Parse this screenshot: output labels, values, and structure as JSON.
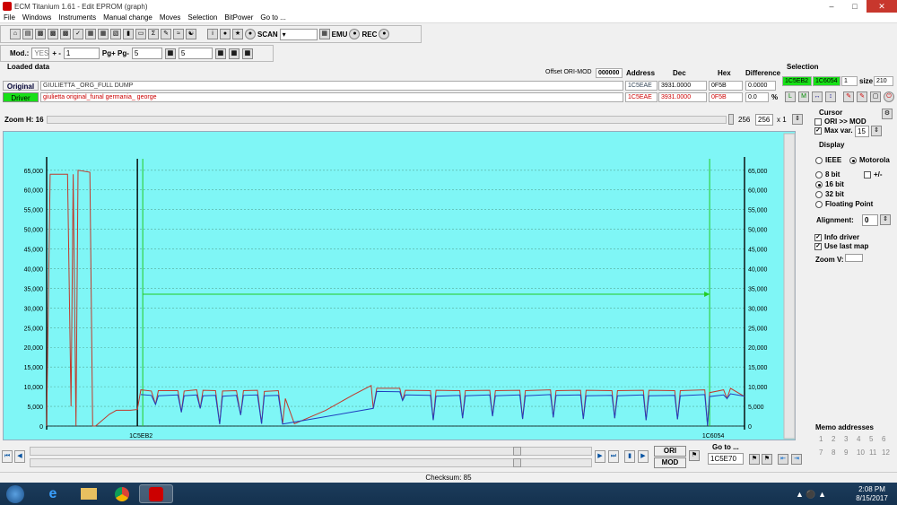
{
  "window": {
    "title": "ECM Titanium 1.61 - Edit EPROM (graph)"
  },
  "menu": [
    "File",
    "Windows",
    "Instruments",
    "Manual change",
    "Moves",
    "Selection",
    "BitPower",
    "Go to ..."
  ],
  "toolbar": {
    "scan_label": "SCAN",
    "emu_label": "EMU",
    "rec_label": "REC"
  },
  "toolbar2": {
    "mod_label": "Mod.:",
    "mod_value": "YES",
    "plusminus_label": "+ -",
    "plusminus_value": "1",
    "pg_label": "Pg+ Pg-",
    "pg_value": "5",
    "bit_value": "5"
  },
  "loaded": {
    "title": "Loaded data",
    "offset_label": "Offset ORI-MOD",
    "offset_value": "000000",
    "headers": {
      "address": "Address",
      "dec": "Dec",
      "hex": "Hex",
      "difference": "Difference"
    },
    "original": {
      "label": "Original",
      "name": "GIULIETTA _ORG_FULL DUMP",
      "address": "1C5EAE",
      "dec": "3931.0000",
      "hex": "0F5B",
      "difference": "0.0000"
    },
    "driver": {
      "label": "Driver",
      "name": "giulietta original_funal germania_ george",
      "address": "1C5EAE",
      "dec": "3931.0000",
      "hex": "0F5B",
      "difference": "0.0",
      "pct": "%"
    }
  },
  "selection": {
    "title": "Selection",
    "start": "1C5EB2",
    "end": "1C6054",
    "one": "1",
    "size_label": "size",
    "size_value": "210"
  },
  "zoom": {
    "label": "Zoom H: 16",
    "v1": "256",
    "v2": "256",
    "mult": "x 1"
  },
  "cursor": {
    "title": "Cursor",
    "ori_mod": "ORI >> MOD",
    "maxvar_label": "Max var.",
    "maxvar_value": "15"
  },
  "display": {
    "title": "Display",
    "ieee": "IEEE",
    "motorola": "Motorola",
    "bit8": "8 bit",
    "plusminus": "+/-",
    "bit16": "16 bit",
    "bit32": "32 bit",
    "float": "Floating Point",
    "alignment_label": "Alignment:",
    "alignment_value": "0",
    "info_driver": "Info driver",
    "use_last_map": "Use last map",
    "zoomv": "Zoom V:"
  },
  "memo": {
    "title": "Memo addresses",
    "numbers": [
      "1",
      "2",
      "3",
      "4",
      "5",
      "6",
      "7",
      "8",
      "9",
      "10",
      "11",
      "12"
    ]
  },
  "goto": {
    "label": "Go to ...",
    "value": "1C5E70",
    "ori": "ORI",
    "mod": "MOD"
  },
  "status": {
    "checksum": "Checksum: 85"
  },
  "clock": {
    "time": "2:08 PM",
    "date": "8/15/2017"
  },
  "chart_data": {
    "type": "line",
    "y_ticks": [
      "0",
      "5,000",
      "10,000",
      "15,000",
      "20,000",
      "25,000",
      "30,000",
      "35,000",
      "40,000",
      "45,000",
      "50,000",
      "55,000",
      "60,000",
      "65,000"
    ],
    "ylim": [
      0,
      67000
    ],
    "xlim": [
      0,
      100
    ],
    "markers": [
      {
        "label": "1C5EB2",
        "x": 13
      },
      {
        "label": "1C6054",
        "x": 95
      }
    ],
    "series": [
      {
        "color": "#c0392b",
        "points": [
          [
            0,
            0
          ],
          [
            0.5,
            64000
          ],
          [
            3,
            64000
          ],
          [
            3.5,
            5000
          ],
          [
            3.8,
            64000
          ],
          [
            4.2,
            0
          ],
          [
            4.5,
            65000
          ],
          [
            6.2,
            64500
          ],
          [
            6.6,
            0
          ],
          [
            7,
            0
          ],
          [
            9,
            3000
          ],
          [
            10,
            4000
          ],
          [
            12,
            4000
          ],
          [
            13,
            4200
          ],
          [
            13.5,
            9200
          ],
          [
            15,
            8900
          ],
          [
            15.6,
            5500
          ],
          [
            16,
            9000
          ],
          [
            18.8,
            9000
          ],
          [
            19.3,
            3500
          ],
          [
            19.7,
            8900
          ],
          [
            21.5,
            9200
          ],
          [
            22,
            4500
          ],
          [
            22.4,
            9100
          ],
          [
            24.2,
            9000
          ],
          [
            24.8,
            500
          ],
          [
            25.2,
            8900
          ],
          [
            27.2,
            9000
          ],
          [
            27.8,
            2800
          ],
          [
            28.2,
            9000
          ],
          [
            30.2,
            9100
          ],
          [
            30.8,
            600
          ],
          [
            31.2,
            8800
          ],
          [
            33.2,
            9000
          ],
          [
            33.8,
            500
          ],
          [
            34.2,
            7000
          ],
          [
            35.5,
            600
          ],
          [
            40,
            4000
          ],
          [
            44,
            8000
          ],
          [
            46.5,
            10300
          ],
          [
            46.8,
            4500
          ],
          [
            47.3,
            9600
          ],
          [
            50.6,
            9600
          ],
          [
            51,
            6500
          ],
          [
            51.4,
            9100
          ],
          [
            55,
            9000
          ],
          [
            55.4,
            1500
          ],
          [
            55.8,
            9100
          ],
          [
            59.2,
            9000
          ],
          [
            59.6,
            2000
          ],
          [
            60,
            9000
          ],
          [
            63.5,
            9100
          ],
          [
            63.9,
            2500
          ],
          [
            64.3,
            9000
          ],
          [
            67.8,
            9100
          ],
          [
            68.2,
            1800
          ],
          [
            68.6,
            9000
          ],
          [
            72.2,
            9200
          ],
          [
            72.6,
            2200
          ],
          [
            73,
            9000
          ],
          [
            76.5,
            9100
          ],
          [
            76.9,
            1800
          ],
          [
            77.3,
            9100
          ],
          [
            81,
            9000
          ],
          [
            81.4,
            2000
          ],
          [
            81.8,
            9000
          ],
          [
            85.5,
            9100
          ],
          [
            85.9,
            1500
          ],
          [
            86.3,
            9100
          ],
          [
            90,
            9000
          ],
          [
            90.4,
            1700
          ],
          [
            90.8,
            9000
          ],
          [
            94.3,
            9200
          ],
          [
            94.7,
            100
          ],
          [
            95,
            8500
          ],
          [
            97,
            9200
          ],
          [
            97.5,
            7000
          ],
          [
            98,
            9600
          ],
          [
            100,
            7500
          ]
        ]
      },
      {
        "color": "#1f3fbf",
        "points": [
          [
            13.5,
            8000
          ],
          [
            15,
            7800
          ],
          [
            15.6,
            5500
          ],
          [
            16,
            7700
          ],
          [
            18.8,
            7900
          ],
          [
            19.3,
            3500
          ],
          [
            19.7,
            7700
          ],
          [
            21.5,
            7900
          ],
          [
            22,
            4500
          ],
          [
            22.4,
            7700
          ],
          [
            24.2,
            7800
          ],
          [
            24.8,
            500
          ],
          [
            25.2,
            7600
          ],
          [
            27.2,
            7800
          ],
          [
            27.8,
            2800
          ],
          [
            28.2,
            7800
          ],
          [
            30.2,
            7900
          ],
          [
            30.8,
            600
          ],
          [
            31.2,
            7700
          ],
          [
            33.2,
            7800
          ],
          [
            33.8,
            500
          ],
          [
            46.8,
            4500
          ],
          [
            47.3,
            8800
          ],
          [
            50.6,
            8700
          ],
          [
            51,
            6500
          ],
          [
            51.4,
            7900
          ],
          [
            55,
            7800
          ],
          [
            55.4,
            1500
          ],
          [
            55.8,
            7600
          ],
          [
            59.2,
            7800
          ],
          [
            59.6,
            2000
          ],
          [
            60,
            7700
          ],
          [
            63.5,
            7900
          ],
          [
            63.9,
            2500
          ],
          [
            64.3,
            7700
          ],
          [
            67.8,
            7900
          ],
          [
            68.2,
            1800
          ],
          [
            68.6,
            7700
          ],
          [
            72.2,
            8000
          ],
          [
            72.6,
            2200
          ],
          [
            73,
            7800
          ],
          [
            76.5,
            7900
          ],
          [
            76.9,
            1800
          ],
          [
            77.3,
            7700
          ],
          [
            81,
            7800
          ],
          [
            81.4,
            2000
          ],
          [
            81.8,
            7700
          ],
          [
            85.5,
            7900
          ],
          [
            85.9,
            1500
          ],
          [
            86.3,
            7700
          ],
          [
            90,
            7800
          ],
          [
            90.4,
            1700
          ],
          [
            90.8,
            7700
          ],
          [
            94.3,
            8000
          ],
          [
            94.7,
            100
          ],
          [
            95,
            7500
          ],
          [
            97,
            7900
          ],
          [
            97.5,
            7000
          ],
          [
            98,
            8200
          ],
          [
            100,
            7600
          ]
        ]
      }
    ],
    "arrow": {
      "y": 33500,
      "x1": 13,
      "x2": 95
    }
  }
}
